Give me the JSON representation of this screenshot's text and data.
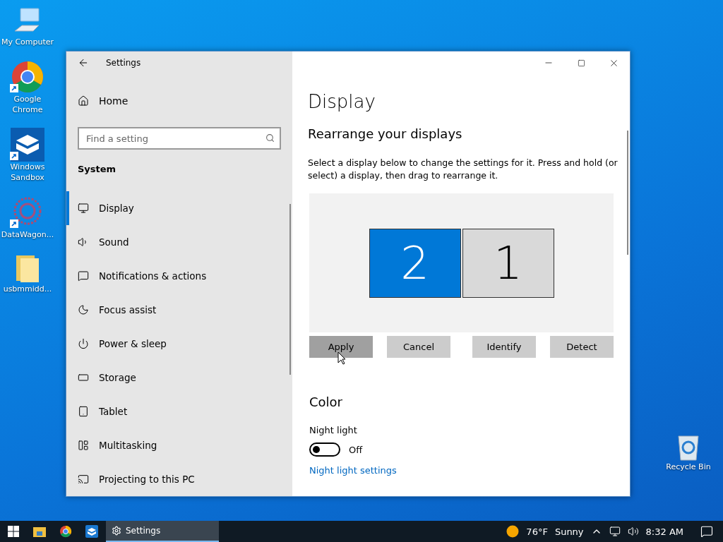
{
  "desktop": {
    "icons": [
      {
        "label": "My Computer",
        "kind": "computer",
        "shortcut": false
      },
      {
        "label": "Google Chrome",
        "kind": "chrome",
        "shortcut": true
      },
      {
        "label": "Windows Sandbox",
        "kind": "sandbox",
        "shortcut": true
      },
      {
        "label": "DataWagon...",
        "kind": "app",
        "shortcut": true
      },
      {
        "label": "usbmmidd...",
        "kind": "folder",
        "shortcut": false
      }
    ],
    "recycle_bin": {
      "label": "Recycle Bin"
    }
  },
  "window": {
    "title": "Settings",
    "sidebar": {
      "home": "Home",
      "search": {
        "placeholder": "Find a setting"
      },
      "section": "System",
      "items": [
        {
          "label": "Display",
          "kind": "display",
          "selected": true
        },
        {
          "label": "Sound",
          "kind": "sound",
          "selected": false
        },
        {
          "label": "Notifications & actions",
          "kind": "notifications",
          "selected": false
        },
        {
          "label": "Focus assist",
          "kind": "focus",
          "selected": false
        },
        {
          "label": "Power & sleep",
          "kind": "power",
          "selected": false
        },
        {
          "label": "Storage",
          "kind": "storage",
          "selected": false
        },
        {
          "label": "Tablet",
          "kind": "tablet",
          "selected": false
        },
        {
          "label": "Multitasking",
          "kind": "multitasking",
          "selected": false
        },
        {
          "label": "Projecting to this PC",
          "kind": "projecting",
          "selected": false
        }
      ]
    },
    "content": {
      "title": "Display",
      "heading": "Rearrange your displays",
      "description": "Select a display below to change the settings for it. Press and hold (or select) a display, then drag to rearrange it.",
      "displays": [
        {
          "number": "2",
          "selected": true
        },
        {
          "number": "1",
          "selected": false
        }
      ],
      "buttons": [
        {
          "label": "Apply",
          "pressed": true
        },
        {
          "label": "Cancel",
          "pressed": false
        },
        {
          "label": "Identify",
          "pressed": false
        },
        {
          "label": "Detect",
          "pressed": false
        }
      ],
      "color_heading": "Color",
      "night_light": {
        "label": "Night light",
        "on": false,
        "state": "Off"
      },
      "link": "Night light settings"
    }
  },
  "taskbar": {
    "pinned": [
      {
        "kind": "explorer"
      },
      {
        "kind": "chrome"
      },
      {
        "kind": "sandbox"
      }
    ],
    "active_app": {
      "label": "Settings",
      "selected": true
    },
    "weather": {
      "temperature": "76°F",
      "condition": "Sunny"
    },
    "clock": "8:32 AM"
  }
}
